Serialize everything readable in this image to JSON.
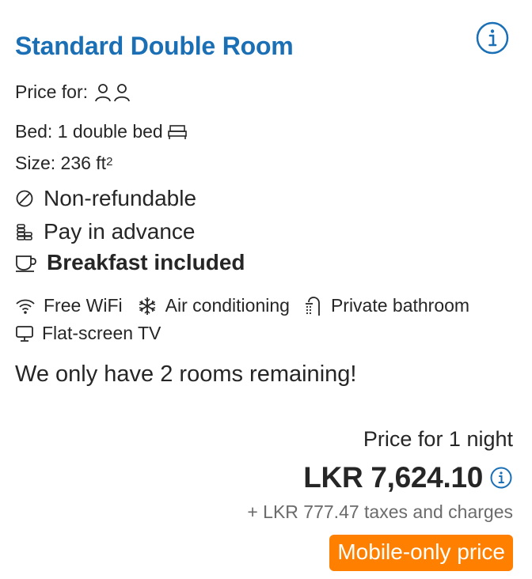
{
  "room": {
    "title": "Standard Double Room",
    "price_for_label": "Price for:",
    "bed_text": "Bed: 1 double bed",
    "size_label": "Size: 236 ft",
    "size_sup": "2"
  },
  "policies": {
    "refund": "Non-refundable",
    "payment": "Pay in advance",
    "breakfast": "Breakfast included"
  },
  "amenities": [
    "Free WiFi",
    "Air conditioning",
    "Private bathroom",
    "Flat-screen TV"
  ],
  "availability": "We only have 2 rooms remaining!",
  "pricing": {
    "label": "Price for 1 night",
    "amount": "LKR 7,624.10",
    "taxes": "+ LKR 777.47 taxes and charges",
    "badge": "Mobile-only price"
  },
  "icons": {
    "info": "info-icon",
    "guests": "person-icon",
    "bed": "bed-icon",
    "refund": "no-icon",
    "payment": "coins-icon",
    "breakfast": "coffee-cup-icon",
    "wifi": "wifi-icon",
    "ac": "snowflake-icon",
    "bath": "shower-icon",
    "tv": "tv-icon"
  },
  "colors": {
    "title": "#1a6fb5",
    "badge": "#ff8000"
  }
}
